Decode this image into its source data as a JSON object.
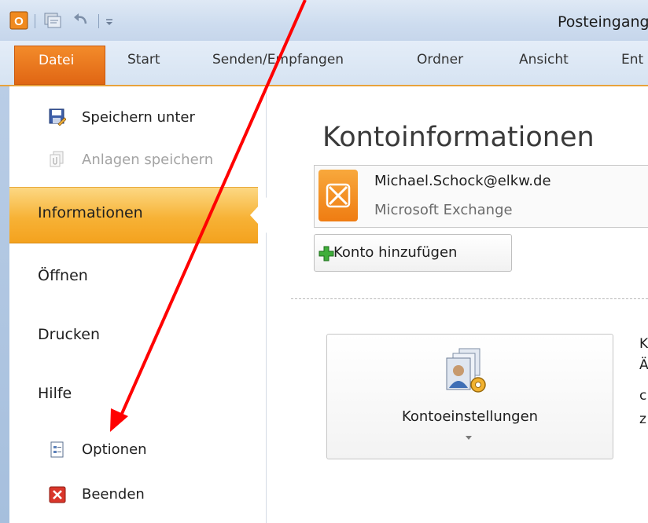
{
  "window": {
    "title": "Posteingang"
  },
  "ribbon": {
    "tabs": [
      {
        "label": "Datei"
      },
      {
        "label": "Start"
      },
      {
        "label": "Senden/Empfangen"
      },
      {
        "label": "Ordner"
      },
      {
        "label": "Ansicht"
      },
      {
        "label": "Ent"
      }
    ]
  },
  "backstage": {
    "commands": [
      {
        "label": "Speichern unter",
        "icon": "save-as-icon",
        "enabled": true
      },
      {
        "label": "Anlagen speichern",
        "icon": "save-attachments-icon",
        "enabled": false
      }
    ],
    "tabs": [
      {
        "label": "Informationen",
        "selected": true
      },
      {
        "label": "Öffnen"
      },
      {
        "label": "Drucken"
      },
      {
        "label": "Hilfe"
      }
    ],
    "bottom_commands": [
      {
        "label": "Optionen",
        "icon": "options-icon"
      },
      {
        "label": "Beenden",
        "icon": "exit-icon"
      }
    ]
  },
  "main": {
    "title": "Kontoinformationen",
    "account": {
      "email": "Michael.Schock@elkw.de",
      "type": "Microsoft Exchange",
      "icon": "exchange-icon"
    },
    "add_account_label": "Konto hinzufügen",
    "settings_button_label": "Kontoeinstellungen",
    "cut_off_text": [
      "K",
      "Ä",
      "c",
      "z"
    ]
  },
  "annotation": {
    "color": "#ff0000"
  }
}
